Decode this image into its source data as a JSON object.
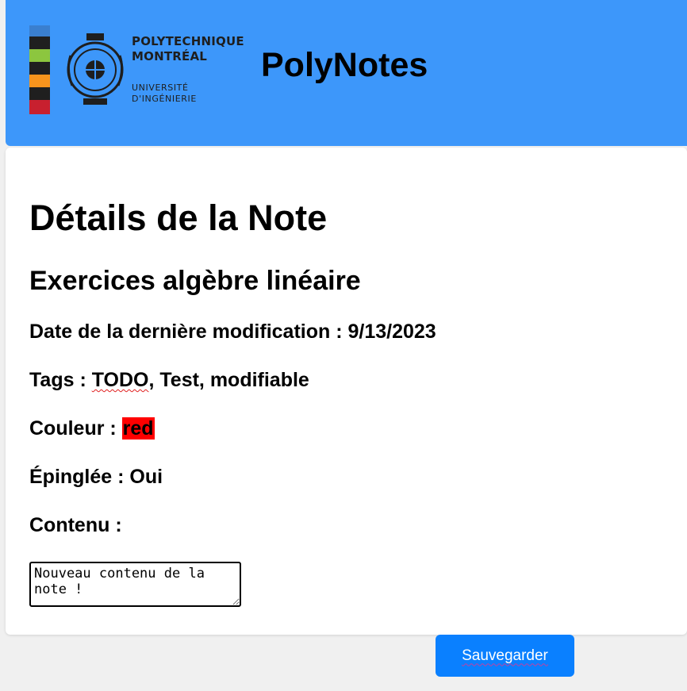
{
  "header": {
    "logo": {
      "line1": "POLYTECHNIQUE",
      "line2": "MONTRÉAL",
      "line3": "UNIVERSITÉ",
      "line4": "D'INGÉNIERIE",
      "bar_colors": [
        "#3a7fcf",
        "#1f1f1f",
        "#8cc63f",
        "#1f1f1f",
        "#f7941d",
        "#1f1f1f",
        "#c8202f"
      ]
    },
    "app_title": "PolyNotes"
  },
  "note": {
    "heading": "Détails de la Note",
    "title": "Exercices algèbre linéaire",
    "modified_label": "Date de la dernière modification : ",
    "modified_value": "9/13/2023",
    "tags_label": "Tags : ",
    "tags": [
      "TODO",
      ", Test, modifiable"
    ],
    "color_label": "Couleur : ",
    "color_value": "red",
    "pinned_label": "Épinglée : ",
    "pinned_value": "Oui",
    "content_label": "Contenu :",
    "content_value": "Nouveau contenu de la note !"
  },
  "actions": {
    "save_label": "Sauvegarder"
  },
  "colors": {
    "header_bg": "#3d97fa",
    "button_bg": "#0a80ff",
    "note_color": "#ff0000"
  }
}
